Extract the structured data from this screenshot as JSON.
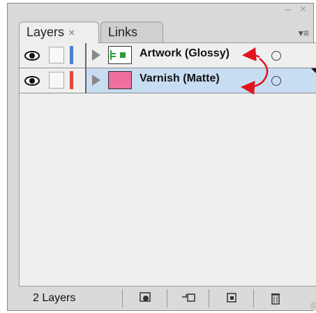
{
  "tabs": [
    {
      "label": "Layers",
      "active": true,
      "close_glyph": "×"
    },
    {
      "label": "Links",
      "active": false
    }
  ],
  "layers": [
    {
      "name": "Artwork (Glossy)",
      "color": "#4a7fd0",
      "thumb": "artwork",
      "selected": false
    },
    {
      "name": "Varnish (Matte)",
      "color": "#e8463a",
      "thumb": "pink",
      "selected": true
    }
  ],
  "status": {
    "count_label": "2 Layers"
  },
  "icons": {
    "eye": "eye-icon",
    "panel_menu": "panel-menu-icon",
    "new_sublayer": "new-sublayer-icon",
    "new_layer": "new-layer-icon",
    "delete": "trash-icon"
  },
  "colors": {
    "annotation_arrow": "#e1141e",
    "selection": "#c7ddf2"
  }
}
